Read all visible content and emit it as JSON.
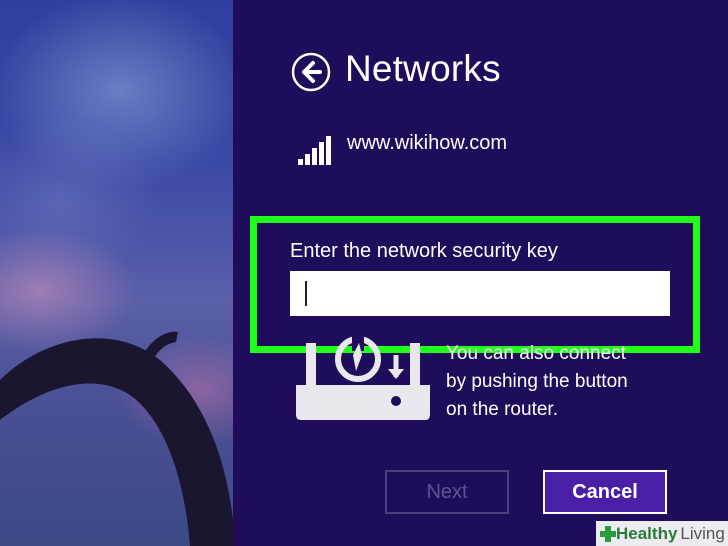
{
  "panel": {
    "title": "Networks",
    "network_name": "www.wikihow.com",
    "key_label": "Enter the network security key",
    "key_input_value": "",
    "alt_text_line1": "You can also connect",
    "alt_text_line2": "by pushing the button",
    "alt_text_line3": "on the router.",
    "next_label": "Next",
    "cancel_label": "Cancel"
  },
  "icons": {
    "back": "back-arrow-icon",
    "signal": "wifi-signal-icon",
    "router": "router-wps-icon"
  },
  "watermark": {
    "brand_strong": "Healthy",
    "brand_light": "Living"
  },
  "colors": {
    "panel_bg": "#1f0d5c",
    "highlight": "#22ff1e",
    "cancel_bg": "#4a1fa8"
  }
}
